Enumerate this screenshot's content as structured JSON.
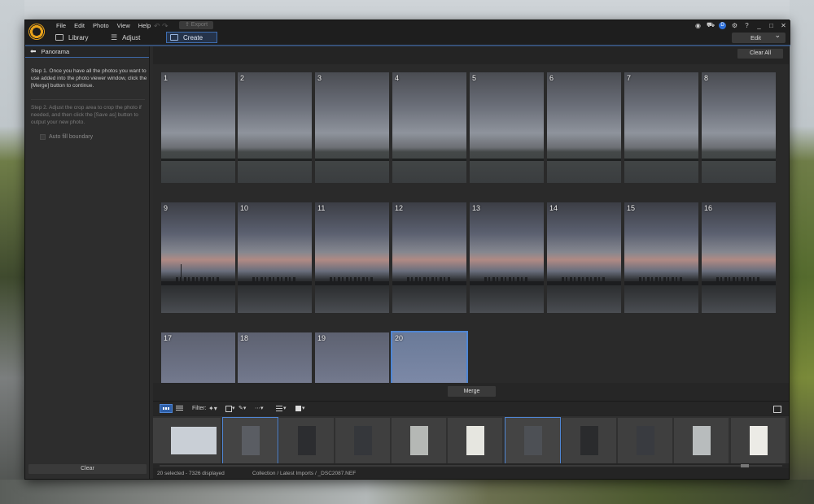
{
  "menu": [
    "File",
    "Edit",
    "Photo",
    "View",
    "Help"
  ],
  "toolbar_top": {
    "export_label": "Export"
  },
  "mode_tabs": [
    {
      "label": "Library",
      "icon": "photo-library-icon"
    },
    {
      "label": "Adjust",
      "icon": "sliders-icon"
    },
    {
      "label": "Create",
      "icon": "create-icon"
    }
  ],
  "system": {
    "user_badge": "D",
    "edit_dropdown": "Edit"
  },
  "panel": {
    "title": "Panorama",
    "step1": "Step 1. Once you have all the photos you want to use added into the photo viewer window, click the [Merge] button to continue.",
    "step2": "Step 2. Adjust the crop area to crop the photo if needed, and then click the [Save as] button to output your new photo.",
    "auto_fill_label": "Auto fill boundary",
    "clear_button": "Clear"
  },
  "viewer": {
    "clear_all": "Clear All",
    "photos": [
      "1",
      "2",
      "3",
      "4",
      "5",
      "6",
      "7",
      "8",
      "9",
      "10",
      "11",
      "12",
      "13",
      "14",
      "15",
      "16",
      "17",
      "18",
      "19",
      "20"
    ],
    "merge_button": "Merge"
  },
  "filmstrip_toolbar": {
    "filter_label": "Filter:"
  },
  "status": {
    "selection": "20 selected - 7326 displayed",
    "path": "Collection / Latest Imports / _DSC2087.NEF"
  },
  "colors": {
    "accent": "#4f86d4",
    "logo": "#e8a21a"
  }
}
